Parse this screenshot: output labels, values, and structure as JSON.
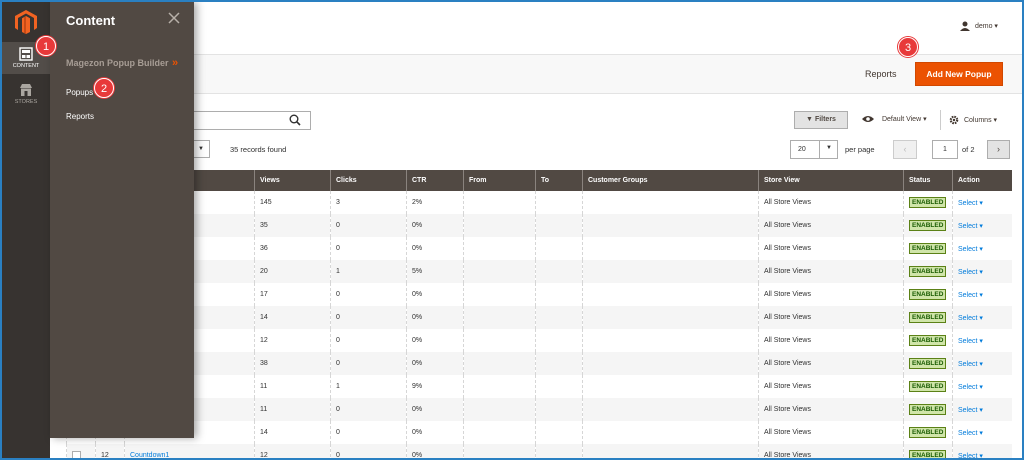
{
  "nav": {
    "content_label": "CONTENT",
    "stores_label": "STORES"
  },
  "flyout": {
    "title": "Content",
    "group": "Magezon Popup Builder",
    "group_arrows": "»",
    "links": [
      "Popups",
      "Reports"
    ]
  },
  "header": {
    "user": "demo",
    "reports_label": "Reports",
    "add_button": "Add New Popup"
  },
  "toolbar": {
    "filters_label": "Filters",
    "default_view": "Default View",
    "columns_label": "Columns",
    "records_found": "35 records found",
    "per_page_value": "20",
    "per_page_label": "per page",
    "page_value": "1",
    "page_of": "of 2",
    "prev": "‹",
    "next": "›"
  },
  "callouts": [
    "1",
    "2",
    "3"
  ],
  "table": {
    "columns": [
      "",
      "",
      "",
      "Views",
      "Clicks",
      "CTR",
      "From",
      "To",
      "Customer Groups",
      "Store View",
      "Status",
      "Action"
    ],
    "status_label": "ENABLED",
    "action_label": "Select",
    "rows": [
      {
        "id": "",
        "name": "",
        "views": "145",
        "clicks": "3",
        "ctr": "2%",
        "store": "All Store Views"
      },
      {
        "id": "",
        "name": "",
        "views": "35",
        "clicks": "0",
        "ctr": "0%",
        "store": "All Store Views"
      },
      {
        "id": "",
        "name": "",
        "views": "36",
        "clicks": "0",
        "ctr": "0%",
        "store": "All Store Views"
      },
      {
        "id": "",
        "name": "",
        "views": "20",
        "clicks": "1",
        "ctr": "5%",
        "store": "All Store Views"
      },
      {
        "id": "",
        "name": "",
        "views": "17",
        "clicks": "0",
        "ctr": "0%",
        "store": "All Store Views"
      },
      {
        "id": "",
        "name": "",
        "views": "14",
        "clicks": "0",
        "ctr": "0%",
        "store": "All Store Views"
      },
      {
        "id": "",
        "name": "",
        "views": "12",
        "clicks": "0",
        "ctr": "0%",
        "store": "All Store Views"
      },
      {
        "id": "",
        "name": "",
        "views": "38",
        "clicks": "0",
        "ctr": "0%",
        "store": "All Store Views"
      },
      {
        "id": "",
        "name": "",
        "views": "11",
        "clicks": "1",
        "ctr": "9%",
        "store": "All Store Views"
      },
      {
        "id": "",
        "name": "",
        "views": "11",
        "clicks": "0",
        "ctr": "0%",
        "store": "All Store Views"
      },
      {
        "id": "",
        "name": "",
        "views": "14",
        "clicks": "0",
        "ctr": "0%",
        "store": "All Store Views"
      },
      {
        "id": "12",
        "name": "Countdown1",
        "views": "12",
        "clicks": "0",
        "ctr": "0%",
        "store": "All Store Views"
      }
    ]
  },
  "colors": {
    "nav_bg": "#373330",
    "flyout_bg": "#514943",
    "accent": "#eb5202",
    "callout": "#e8393a",
    "link": "#007bdb"
  }
}
